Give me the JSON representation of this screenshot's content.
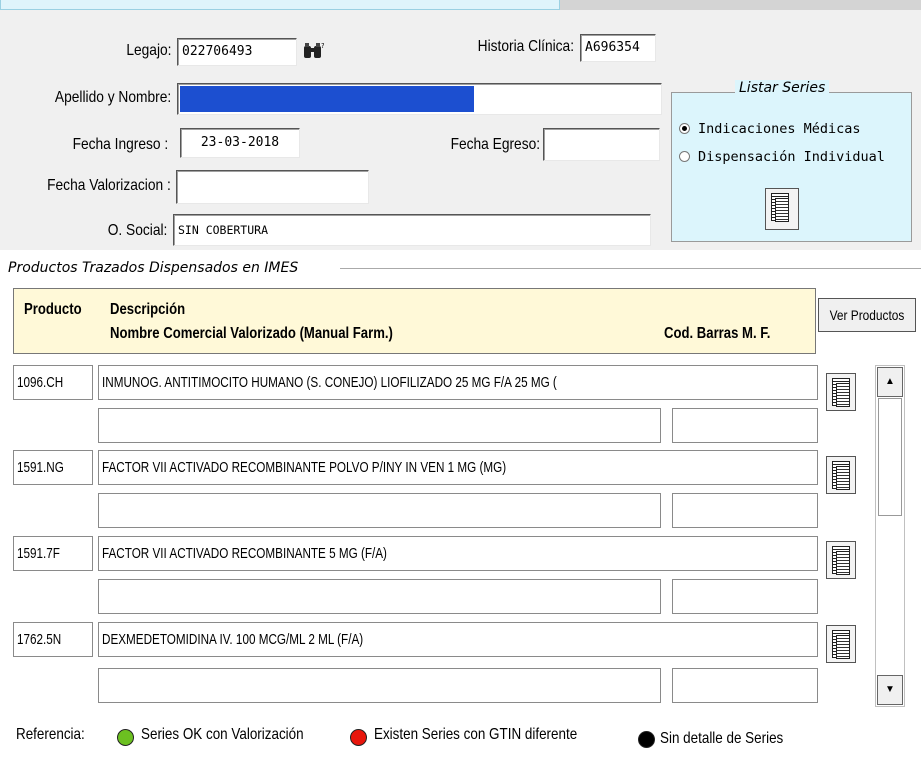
{
  "form": {
    "legajo_label": "Legajo:",
    "legajo_value": "022706493",
    "historia_label": "Historia Clínica:",
    "historia_value": "A696354",
    "apellido_label": "Apellido y Nombre:",
    "apellido_value": "",
    "fecha_ingreso_label": "Fecha Ingreso :",
    "fecha_ingreso_value": "23-03-2018",
    "fecha_egreso_label": "Fecha Egreso:",
    "fecha_egreso_value": "",
    "fecha_valorizacion_label": "Fecha Valorizacion :",
    "fecha_valorizacion_value": "",
    "osocial_label": "O. Social:",
    "osocial_value": "SIN COBERTURA"
  },
  "listar": {
    "title": "Listar Series",
    "options": [
      "Indicaciones Médicas",
      "Dispensación Individual"
    ],
    "selected": "Indicaciones Médicas"
  },
  "productos": {
    "section_title": "Productos Trazados Dispensados en IMES",
    "header": {
      "producto": "Producto",
      "descripcion": "Descripción",
      "nombre_comercial": "Nombre Comercial Valorizado (Manual Farm.)",
      "cod_barras": "Cod. Barras M. F."
    },
    "ver_productos_label": "Ver Productos",
    "rows": [
      {
        "code": "1096.CH",
        "description": "INMUNOG. ANTITIMOCITO HUMANO (S. CONEJO) LIOFILIZADO 25 MG F/A 25 MG (",
        "nombre_comercial": "",
        "cod_barras": ""
      },
      {
        "code": "1591.NG",
        "description": "FACTOR VII ACTIVADO RECOMBINANTE POLVO P/INY IN VEN 1 MG (MG)",
        "nombre_comercial": "",
        "cod_barras": ""
      },
      {
        "code": "1591.7F",
        "description": "FACTOR VII ACTIVADO RECOMBINANTE 5 MG (F/A)",
        "nombre_comercial": "",
        "cod_barras": ""
      },
      {
        "code": "1762.5N",
        "description": "DEXMEDETOMIDINA IV. 100 MCG/ML 2 ML (F/A)",
        "nombre_comercial": "",
        "cod_barras": ""
      }
    ]
  },
  "referencia": {
    "label": "Referencia:",
    "items": [
      {
        "text": "Series OK con Valorización",
        "color": "#6cc021"
      },
      {
        "text": "Existen Series con GTIN diferente",
        "color": "#e8160c"
      },
      {
        "text": "Sin detalle de Series",
        "color": "#000000"
      }
    ]
  },
  "colors": {
    "name_highlight": "#1c4fd0",
    "listar_bg": "#dcf5fc",
    "header_bg": "#fff9d8"
  }
}
